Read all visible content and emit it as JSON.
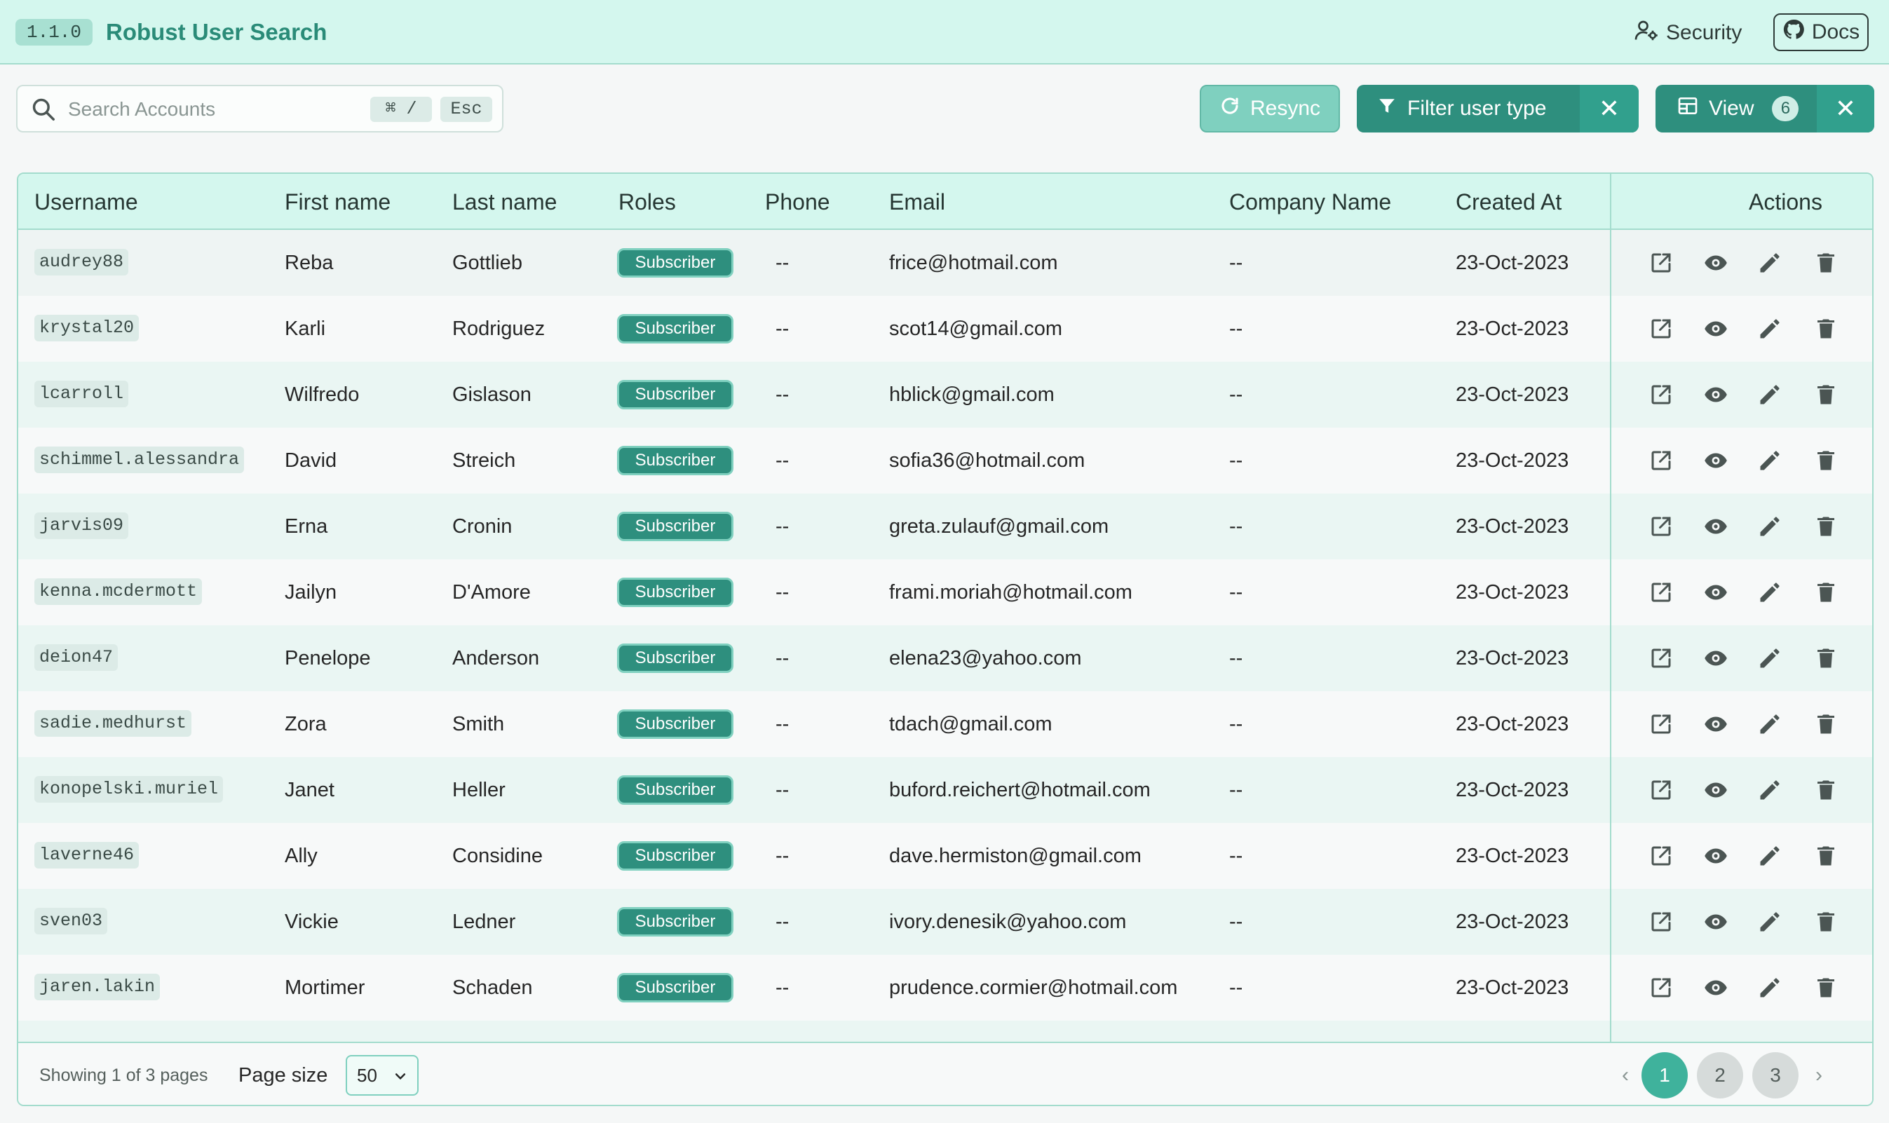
{
  "header": {
    "version": "1.1.0",
    "title": "Robust User Search",
    "security_label": "Security",
    "docs_label": "Docs"
  },
  "toolbar": {
    "search_placeholder": "Search Accounts",
    "search_shortcut": "⌘ /",
    "search_escape": "Esc",
    "resync_label": "Resync",
    "filter_label": "Filter user type",
    "view_label": "View",
    "view_count": "6",
    "clear_symbol": "✕"
  },
  "table": {
    "columns": [
      "Username",
      "First name",
      "Last name",
      "Roles",
      "Phone",
      "Email",
      "Company Name",
      "Created At",
      "Actions"
    ],
    "rows": [
      {
        "username": "audrey88",
        "first": "Reba",
        "last": "Gottlieb",
        "role": "Subscriber",
        "phone": "--",
        "email": "frice@hotmail.com",
        "company": "--",
        "created": "23-Oct-2023"
      },
      {
        "username": "krystal20",
        "first": "Karli",
        "last": "Rodriguez",
        "role": "Subscriber",
        "phone": "--",
        "email": "scot14@gmail.com",
        "company": "--",
        "created": "23-Oct-2023"
      },
      {
        "username": "lcarroll",
        "first": "Wilfredo",
        "last": "Gislason",
        "role": "Subscriber",
        "phone": "--",
        "email": "hblick@gmail.com",
        "company": "--",
        "created": "23-Oct-2023"
      },
      {
        "username": "schimmel.alessandra",
        "first": "David",
        "last": "Streich",
        "role": "Subscriber",
        "phone": "--",
        "email": "sofia36@hotmail.com",
        "company": "--",
        "created": "23-Oct-2023"
      },
      {
        "username": "jarvis09",
        "first": "Erna",
        "last": "Cronin",
        "role": "Subscriber",
        "phone": "--",
        "email": "greta.zulauf@gmail.com",
        "company": "--",
        "created": "23-Oct-2023"
      },
      {
        "username": "kenna.mcdermott",
        "first": "Jailyn",
        "last": "D'Amore",
        "role": "Subscriber",
        "phone": "--",
        "email": "frami.moriah@hotmail.com",
        "company": "--",
        "created": "23-Oct-2023"
      },
      {
        "username": "deion47",
        "first": "Penelope",
        "last": "Anderson",
        "role": "Subscriber",
        "phone": "--",
        "email": "elena23@yahoo.com",
        "company": "--",
        "created": "23-Oct-2023"
      },
      {
        "username": "sadie.medhurst",
        "first": "Zora",
        "last": "Smith",
        "role": "Subscriber",
        "phone": "--",
        "email": "tdach@gmail.com",
        "company": "--",
        "created": "23-Oct-2023"
      },
      {
        "username": "konopelski.muriel",
        "first": "Janet",
        "last": "Heller",
        "role": "Subscriber",
        "phone": "--",
        "email": "buford.reichert@hotmail.com",
        "company": "--",
        "created": "23-Oct-2023"
      },
      {
        "username": "laverne46",
        "first": "Ally",
        "last": "Considine",
        "role": "Subscriber",
        "phone": "--",
        "email": "dave.hermiston@gmail.com",
        "company": "--",
        "created": "23-Oct-2023"
      },
      {
        "username": "sven03",
        "first": "Vickie",
        "last": "Ledner",
        "role": "Subscriber",
        "phone": "--",
        "email": "ivory.denesik@yahoo.com",
        "company": "--",
        "created": "23-Oct-2023"
      },
      {
        "username": "jaren.lakin",
        "first": "Mortimer",
        "last": "Schaden",
        "role": "Subscriber",
        "phone": "--",
        "email": "prudence.cormier@hotmail.com",
        "company": "--",
        "created": "23-Oct-2023"
      },
      {
        "username": "",
        "first": "",
        "last": "",
        "role": "",
        "phone": "",
        "email": "",
        "company": "",
        "created": ""
      }
    ],
    "row_actions": [
      "open-external-icon",
      "eye-icon",
      "pencil-icon",
      "trash-icon"
    ]
  },
  "footer": {
    "showing_text": "Showing 1 of 3 pages",
    "page_size_label": "Page size",
    "page_size_value": "50",
    "pages": [
      "1",
      "2",
      "3"
    ],
    "current_page": "1",
    "prev_symbol": "‹",
    "next_symbol": "›"
  },
  "colors": {
    "accent": "#2e8f7e",
    "header_bg": "#d4f7ee",
    "border": "#a3dccd",
    "title": "#2a8b78"
  }
}
